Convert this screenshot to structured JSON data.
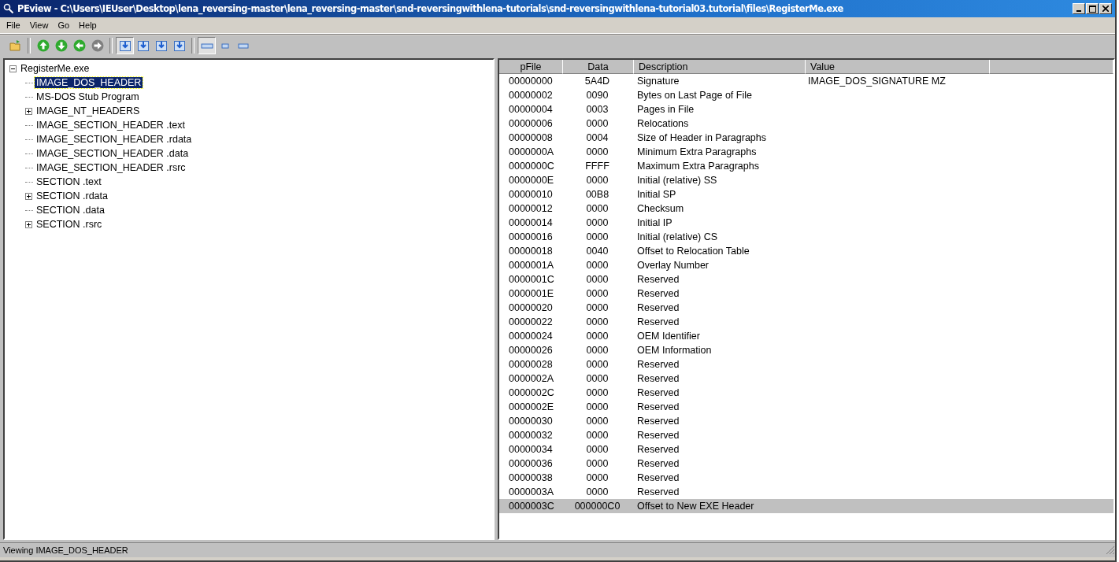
{
  "window": {
    "title": "PEview - C:\\Users\\IEUser\\Desktop\\lena_reversing-master\\lena_reversing-master\\snd-reversingwithlena-tutorials\\snd-reversingwithlena-tutorial03.tutorial\\files\\RegisterMe.exe"
  },
  "menu": [
    "File",
    "View",
    "Go",
    "Help"
  ],
  "toolbar": [
    {
      "kind": "open"
    },
    {
      "kind": "sep"
    },
    {
      "kind": "up",
      "disabled": false
    },
    {
      "kind": "down",
      "disabled": false
    },
    {
      "kind": "back",
      "disabled": false
    },
    {
      "kind": "forward",
      "disabled": true
    },
    {
      "kind": "sep"
    },
    {
      "kind": "view1",
      "pressed": true
    },
    {
      "kind": "view2",
      "pressed": false
    },
    {
      "kind": "view3",
      "pressed": false
    },
    {
      "kind": "view4",
      "pressed": false
    },
    {
      "kind": "sep"
    },
    {
      "kind": "mode1",
      "pressed": true
    },
    {
      "kind": "mode2",
      "pressed": false
    },
    {
      "kind": "mode3",
      "pressed": false
    }
  ],
  "tree": [
    {
      "label": "RegisterMe.exe",
      "selected": false,
      "expanded": true,
      "children": [
        {
          "label": "IMAGE_DOS_HEADER",
          "selected": true
        },
        {
          "label": "MS-DOS Stub Program",
          "selected": false
        },
        {
          "label": "IMAGE_NT_HEADERS",
          "selected": false,
          "expanded": false
        },
        {
          "label": "IMAGE_SECTION_HEADER .text",
          "selected": false
        },
        {
          "label": "IMAGE_SECTION_HEADER .rdata",
          "selected": false
        },
        {
          "label": "IMAGE_SECTION_HEADER .data",
          "selected": false
        },
        {
          "label": "IMAGE_SECTION_HEADER .rsrc",
          "selected": false
        },
        {
          "label": "SECTION .text",
          "selected": false
        },
        {
          "label": "SECTION .rdata",
          "selected": false,
          "expanded": false
        },
        {
          "label": "SECTION .data",
          "selected": false
        },
        {
          "label": "SECTION .rsrc",
          "selected": false,
          "expanded": false
        }
      ]
    }
  ],
  "table": {
    "columns": [
      "pFile",
      "Data",
      "Description",
      "Value"
    ],
    "rows": [
      {
        "pfile": "00000000",
        "data": "5A4D",
        "description": "Signature",
        "value": "IMAGE_DOS_SIGNATURE  MZ",
        "selected": false
      },
      {
        "pfile": "00000002",
        "data": "0090",
        "description": "Bytes on Last Page of File",
        "selected": false
      },
      {
        "pfile": "00000004",
        "data": "0003",
        "description": "Pages in File",
        "selected": false
      },
      {
        "pfile": "00000006",
        "data": "0000",
        "description": "Relocations",
        "selected": false
      },
      {
        "pfile": "00000008",
        "data": "0004",
        "description": "Size of Header in Paragraphs",
        "selected": false
      },
      {
        "pfile": "0000000A",
        "data": "0000",
        "description": "Minimum Extra Paragraphs",
        "selected": false
      },
      {
        "pfile": "0000000C",
        "data": "FFFF",
        "description": "Maximum Extra Paragraphs",
        "selected": false
      },
      {
        "pfile": "0000000E",
        "data": "0000",
        "description": "Initial (relative) SS",
        "selected": false
      },
      {
        "pfile": "00000010",
        "data": "00B8",
        "description": "Initial SP",
        "selected": false
      },
      {
        "pfile": "00000012",
        "data": "0000",
        "description": "Checksum",
        "selected": false
      },
      {
        "pfile": "00000014",
        "data": "0000",
        "description": "Initial IP",
        "selected": false
      },
      {
        "pfile": "00000016",
        "data": "0000",
        "description": "Initial (relative) CS",
        "selected": false
      },
      {
        "pfile": "00000018",
        "data": "0040",
        "description": "Offset to Relocation Table",
        "selected": false
      },
      {
        "pfile": "0000001A",
        "data": "0000",
        "description": "Overlay Number",
        "selected": false
      },
      {
        "pfile": "0000001C",
        "data": "0000",
        "description": "Reserved",
        "selected": false
      },
      {
        "pfile": "0000001E",
        "data": "0000",
        "description": "Reserved",
        "selected": false
      },
      {
        "pfile": "00000020",
        "data": "0000",
        "description": "Reserved",
        "selected": false
      },
      {
        "pfile": "00000022",
        "data": "0000",
        "description": "Reserved",
        "selected": false
      },
      {
        "pfile": "00000024",
        "data": "0000",
        "description": "OEM Identifier",
        "selected": false
      },
      {
        "pfile": "00000026",
        "data": "0000",
        "description": "OEM Information",
        "selected": false
      },
      {
        "pfile": "00000028",
        "data": "0000",
        "description": "Reserved",
        "selected": false
      },
      {
        "pfile": "0000002A",
        "data": "0000",
        "description": "Reserved",
        "selected": false
      },
      {
        "pfile": "0000002C",
        "data": "0000",
        "description": "Reserved",
        "selected": false
      },
      {
        "pfile": "0000002E",
        "data": "0000",
        "description": "Reserved",
        "selected": false
      },
      {
        "pfile": "00000030",
        "data": "0000",
        "description": "Reserved",
        "selected": false
      },
      {
        "pfile": "00000032",
        "data": "0000",
        "description": "Reserved",
        "selected": false
      },
      {
        "pfile": "00000034",
        "data": "0000",
        "description": "Reserved",
        "selected": false
      },
      {
        "pfile": "00000036",
        "data": "0000",
        "description": "Reserved",
        "selected": false
      },
      {
        "pfile": "00000038",
        "data": "0000",
        "description": "Reserved",
        "selected": false
      },
      {
        "pfile": "0000003A",
        "data": "0000",
        "description": "Reserved",
        "selected": false
      },
      {
        "pfile": "0000003C",
        "data": "000000C0",
        "description": "Offset to New EXE Header",
        "selected": true
      }
    ]
  },
  "status_bar": "Viewing IMAGE_DOS_HEADER"
}
